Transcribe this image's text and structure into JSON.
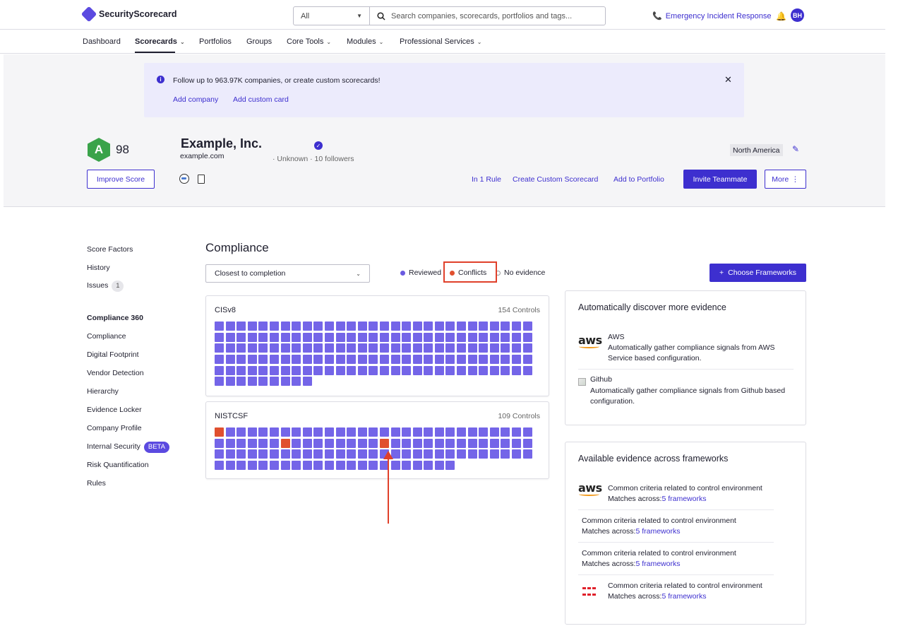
{
  "topbar": {
    "brand": "SecurityScorecard",
    "search_scope": "All",
    "search_placeholder": "Search companies, scorecards, portfolios and tags...",
    "emergency_label": "Emergency Incident Response",
    "avatar_initials": "BH"
  },
  "nav": {
    "items": [
      {
        "label": "Dashboard",
        "active": false,
        "has_menu": false
      },
      {
        "label": "Scorecards",
        "active": true,
        "has_menu": true
      },
      {
        "label": "Portfolios",
        "active": false,
        "has_menu": false
      },
      {
        "label": "Groups",
        "active": false,
        "has_menu": false
      },
      {
        "label": "Core Tools",
        "active": false,
        "has_menu": true
      },
      {
        "label": "Modules",
        "active": false,
        "has_menu": true
      },
      {
        "label": "Professional Services",
        "active": false,
        "has_menu": true
      }
    ]
  },
  "banner": {
    "text": "Follow up to 963.97K companies, or create custom scorecards!",
    "add_company": "Add company",
    "add_custom_card": "Add custom card"
  },
  "company": {
    "grade": "A",
    "score": "98",
    "name": "Example, Inc.",
    "domain": "example.com",
    "meta": "· Unknown · 10 followers",
    "region": "North America",
    "improve_label": "Improve Score"
  },
  "actions": {
    "rule": "In 1 Rule",
    "custom_scorecard": "Create Custom Scorecard",
    "add_portfolio": "Add to Portfolio",
    "invite": "Invite Teammate",
    "more": "More"
  },
  "sidebar": {
    "top": [
      {
        "label": "Score Factors"
      },
      {
        "label": "History"
      },
      {
        "label": "Issues",
        "count": "1"
      }
    ],
    "section_heading": "Compliance 360",
    "section": [
      {
        "label": "Compliance"
      },
      {
        "label": "Digital Footprint"
      },
      {
        "label": "Vendor Detection"
      },
      {
        "label": "Hierarchy"
      },
      {
        "label": "Evidence Locker"
      },
      {
        "label": "Company Profile"
      },
      {
        "label": "Internal Security",
        "badge": "BETA"
      },
      {
        "label": "Risk Quantification"
      },
      {
        "label": "Rules"
      }
    ]
  },
  "compliance": {
    "title": "Compliance",
    "sort_value": "Closest to completion",
    "legend": [
      {
        "label": "Reviewed",
        "color": "#6a5ae0"
      },
      {
        "label": "Conflicts",
        "color": "#e0502f"
      },
      {
        "label": "No evidence",
        "color": "#ffffff"
      }
    ],
    "choose_label": "Choose Frameworks",
    "frameworks": [
      {
        "name": "CISv8",
        "controls_label": "154 Controls",
        "squares": 154,
        "conflicts": []
      },
      {
        "name": "NISTCSF",
        "controls_label": "109 Controls",
        "squares": 109,
        "conflicts": [
          0,
          35,
          44
        ]
      }
    ]
  },
  "colors": {
    "accent": "#3d2fcf",
    "reviewed": "#7465e8",
    "conflict": "#e0502f",
    "grade_green": "#3aa34a",
    "annotation_red": "#e0402a"
  },
  "discover": {
    "title": "Automatically discover more evidence",
    "items": [
      {
        "logo": "aws",
        "name": "AWS",
        "desc_1": "Automatically gather compliance signals from AWS",
        "desc_2": "Service based configuration."
      },
      {
        "logo": "github-broken-image",
        "name": "Github",
        "desc_1": "Automatically gather compliance signals from Github based",
        "desc_2": "configuration."
      }
    ]
  },
  "available": {
    "title": "Available evidence across frameworks",
    "items": [
      {
        "logo": "aws",
        "title": "Common criteria related to control environment",
        "matches_prefix": "Matches across:",
        "matches_link": "5 frameworks"
      },
      {
        "logo": "",
        "title": "Common criteria related to control environment",
        "matches_prefix": "Matches across:",
        "matches_link": "5 frameworks"
      },
      {
        "logo": "",
        "title": "Common criteria related to control environment",
        "matches_prefix": "Matches across:",
        "matches_link": "5 frameworks"
      },
      {
        "logo": "fortinet",
        "title": "Common criteria related to control environment",
        "matches_prefix": "Matches across:",
        "matches_link": "5 frameworks"
      }
    ]
  }
}
